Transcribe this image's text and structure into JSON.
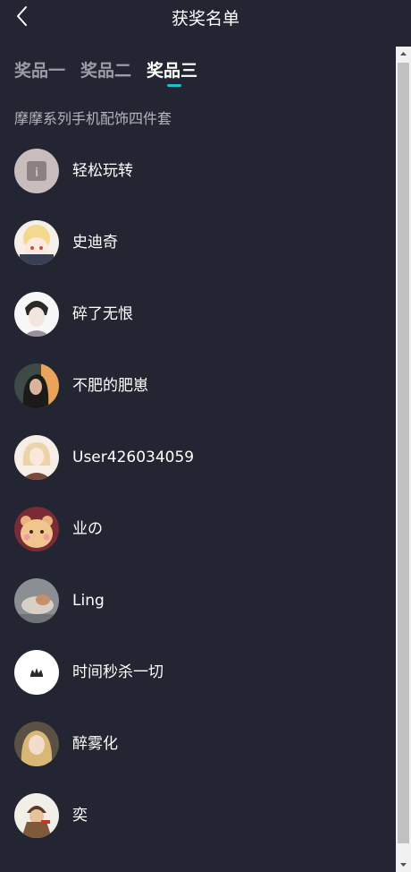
{
  "header": {
    "title": "获奖名单",
    "back_icon": "chevron-left-icon"
  },
  "tabs": [
    {
      "label": "奖品一",
      "active": false
    },
    {
      "label": "奖品二",
      "active": false
    },
    {
      "label": "奖品三",
      "active": true
    }
  ],
  "accent_color": "#19c3c6",
  "prize_name": "摩摩系列手机配饰四件套",
  "winners": [
    {
      "name": "轻松玩转"
    },
    {
      "name": "史迪奇"
    },
    {
      "name": "碎了无恨"
    },
    {
      "name": "不肥的肥崽"
    },
    {
      "name": "User426034059"
    },
    {
      "name": "业の"
    },
    {
      "name": "Ling"
    },
    {
      "name": "时间秒杀一切"
    },
    {
      "name": "醉雾化"
    },
    {
      "name": "奕"
    }
  ]
}
